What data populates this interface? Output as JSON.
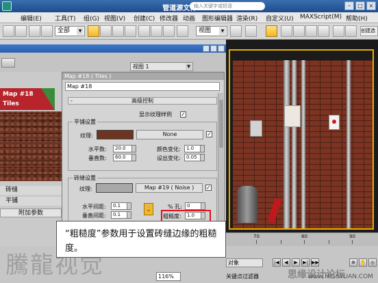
{
  "window": {
    "title": "管道源文件.max",
    "search_placeholder": "输入关键字或短语"
  },
  "menu": [
    "编辑(E)",
    "工具(T)",
    "组(G)",
    "视图(V)",
    "创建(C)",
    "修改器",
    "动画",
    "图形编辑器",
    "渲染(R)",
    "自定义(U)",
    "MAXScript(M)",
    "帮助(H)"
  ],
  "toolbar": {
    "selection_filter": "全部",
    "reference_coord": "视图",
    "create_selection": "创建选"
  },
  "material_editor": {
    "viewport_dropdown": "视图 1",
    "nav": {
      "map_label": "Map #18",
      "map_type": "Tiles",
      "item_bond": "砖缝",
      "item_flat": "平铺",
      "extra_params": "附加参数"
    },
    "map_dialog": {
      "title": "Map #18  ( Tiles )",
      "name_field": "Map #18",
      "rollout_title": "高级控制",
      "rollout_toggle": "-",
      "show_texture_sample": "显示纹理样例",
      "tiles_group": {
        "label": "平铺设置",
        "texture_label": "纹理:",
        "texture_color": "#6b3522",
        "map_button": "None",
        "h_count_label": "水平数:",
        "h_count": "20.0",
        "v_count_label": "垂直数:",
        "v_count": "60.0",
        "color_var_label": "颜色变化:",
        "color_var": "1.0",
        "fade_var_label": "设出变化:",
        "fade_var": "0.05"
      },
      "grout_group": {
        "label": "砖缝设置",
        "texture_label": "纹理:",
        "texture_color": "#a8a8a8",
        "map_button": "Map #19 ( Noise )",
        "h_gap_label": "水平间距:",
        "h_gap": "0.1",
        "v_gap_label": "垂直间距:",
        "v_gap": "0.1",
        "holes_label": "% 孔:",
        "holes": "0",
        "roughness_label": "粗糙度:",
        "roughness": "1.0"
      }
    }
  },
  "timeline": {
    "ticks": [
      "70",
      "80",
      "90"
    ]
  },
  "status": {
    "object_dropdown": "对象",
    "key_filter": "关键点过滤器",
    "zoom_dropdown": "116%"
  },
  "callout": {
    "text": "“粗糙度”参数用于设置砖缝边缘的粗糙度。"
  },
  "watermark": {
    "left": "騰龍视觉",
    "right": "思缘设计论坛",
    "url": "www.MISSYUAN.COM"
  }
}
